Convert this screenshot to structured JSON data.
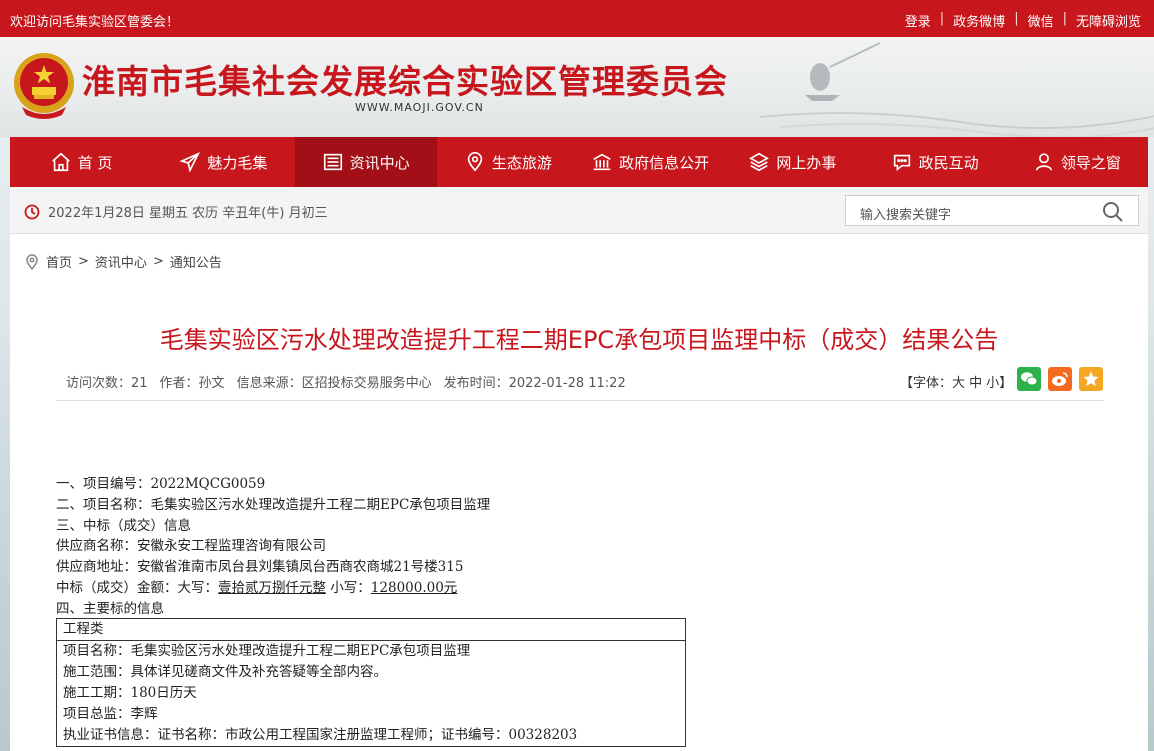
{
  "topbar": {
    "welcome": "欢迎访问毛集实验区管委会！",
    "links": [
      "登录",
      "政务微博",
      "微信",
      "无障碍浏览"
    ]
  },
  "header": {
    "title": "淮南市毛集社会发展综合实验区管理委员会",
    "url": "WWW.MAOJI.GOV.CN"
  },
  "nav": {
    "items": [
      {
        "label": "首 页",
        "icon": "home-icon"
      },
      {
        "label": "魅力毛集",
        "icon": "paper-plane-icon"
      },
      {
        "label": "资讯中心",
        "icon": "newspaper-icon",
        "active": true
      },
      {
        "label": "生态旅游",
        "icon": "map-pin-icon"
      },
      {
        "label": "政府信息公开",
        "icon": "building-icon"
      },
      {
        "label": "网上办事",
        "icon": "layers-icon"
      },
      {
        "label": "政民互动",
        "icon": "chat-icon"
      },
      {
        "label": "领导之窗",
        "icon": "person-icon"
      }
    ]
  },
  "infobar": {
    "date": "2022年1月28日 星期五 农历 辛丑年(牛) 月初三",
    "search_placeholder": "输入搜索关键字"
  },
  "breadcrumb": [
    "首页",
    "资讯中心",
    "通知公告"
  ],
  "article": {
    "title": "毛集实验区污水处理改造提升工程二期EPC承包项目监理中标（成交）结果公告",
    "meta": {
      "visits": "访问次数：21",
      "author": "作者：孙文",
      "source": "信息来源：区招投标交易服务中心",
      "time": "发布时间：2022-01-28 11:22"
    },
    "font_size": "【字体：大 中 小】",
    "lines": [
      "一、项目编号：2022MQCG0059",
      "二、项目名称：毛集实验区污水处理改造提升工程二期EPC承包项目监理",
      "三、中标（成交）信息",
      "供应商名称：安徽永安工程监理咨询有限公司",
      "供应商地址：安徽省淮南市凤台县刘集镇凤台西商农商城21号楼315"
    ],
    "amount": {
      "prefix": "中标（成交）金额：大写：",
      "upper": "壹拾贰万捌仟元整",
      "mid": " 小写：",
      "lower": "128000.00元"
    },
    "line_after": "四、主要标的信息",
    "table": {
      "header": "工程类",
      "rows": [
        "项目名称：毛集实验区污水处理改造提升工程二期EPC承包项目监理",
        "施工范围：具体详见磋商文件及补充答疑等全部内容。",
        "施工工期：180日历天",
        "项目总监：李辉",
        "执业证书信息：证书名称：市政公用工程国家注册监理工程师；证书编号：00328203"
      ]
    }
  },
  "colors": {
    "brand_red": "#c8161d",
    "active_red": "#a20f16",
    "wechat": "#2bb24c",
    "weibo": "#f36b21",
    "favorite": "#f5a623"
  }
}
